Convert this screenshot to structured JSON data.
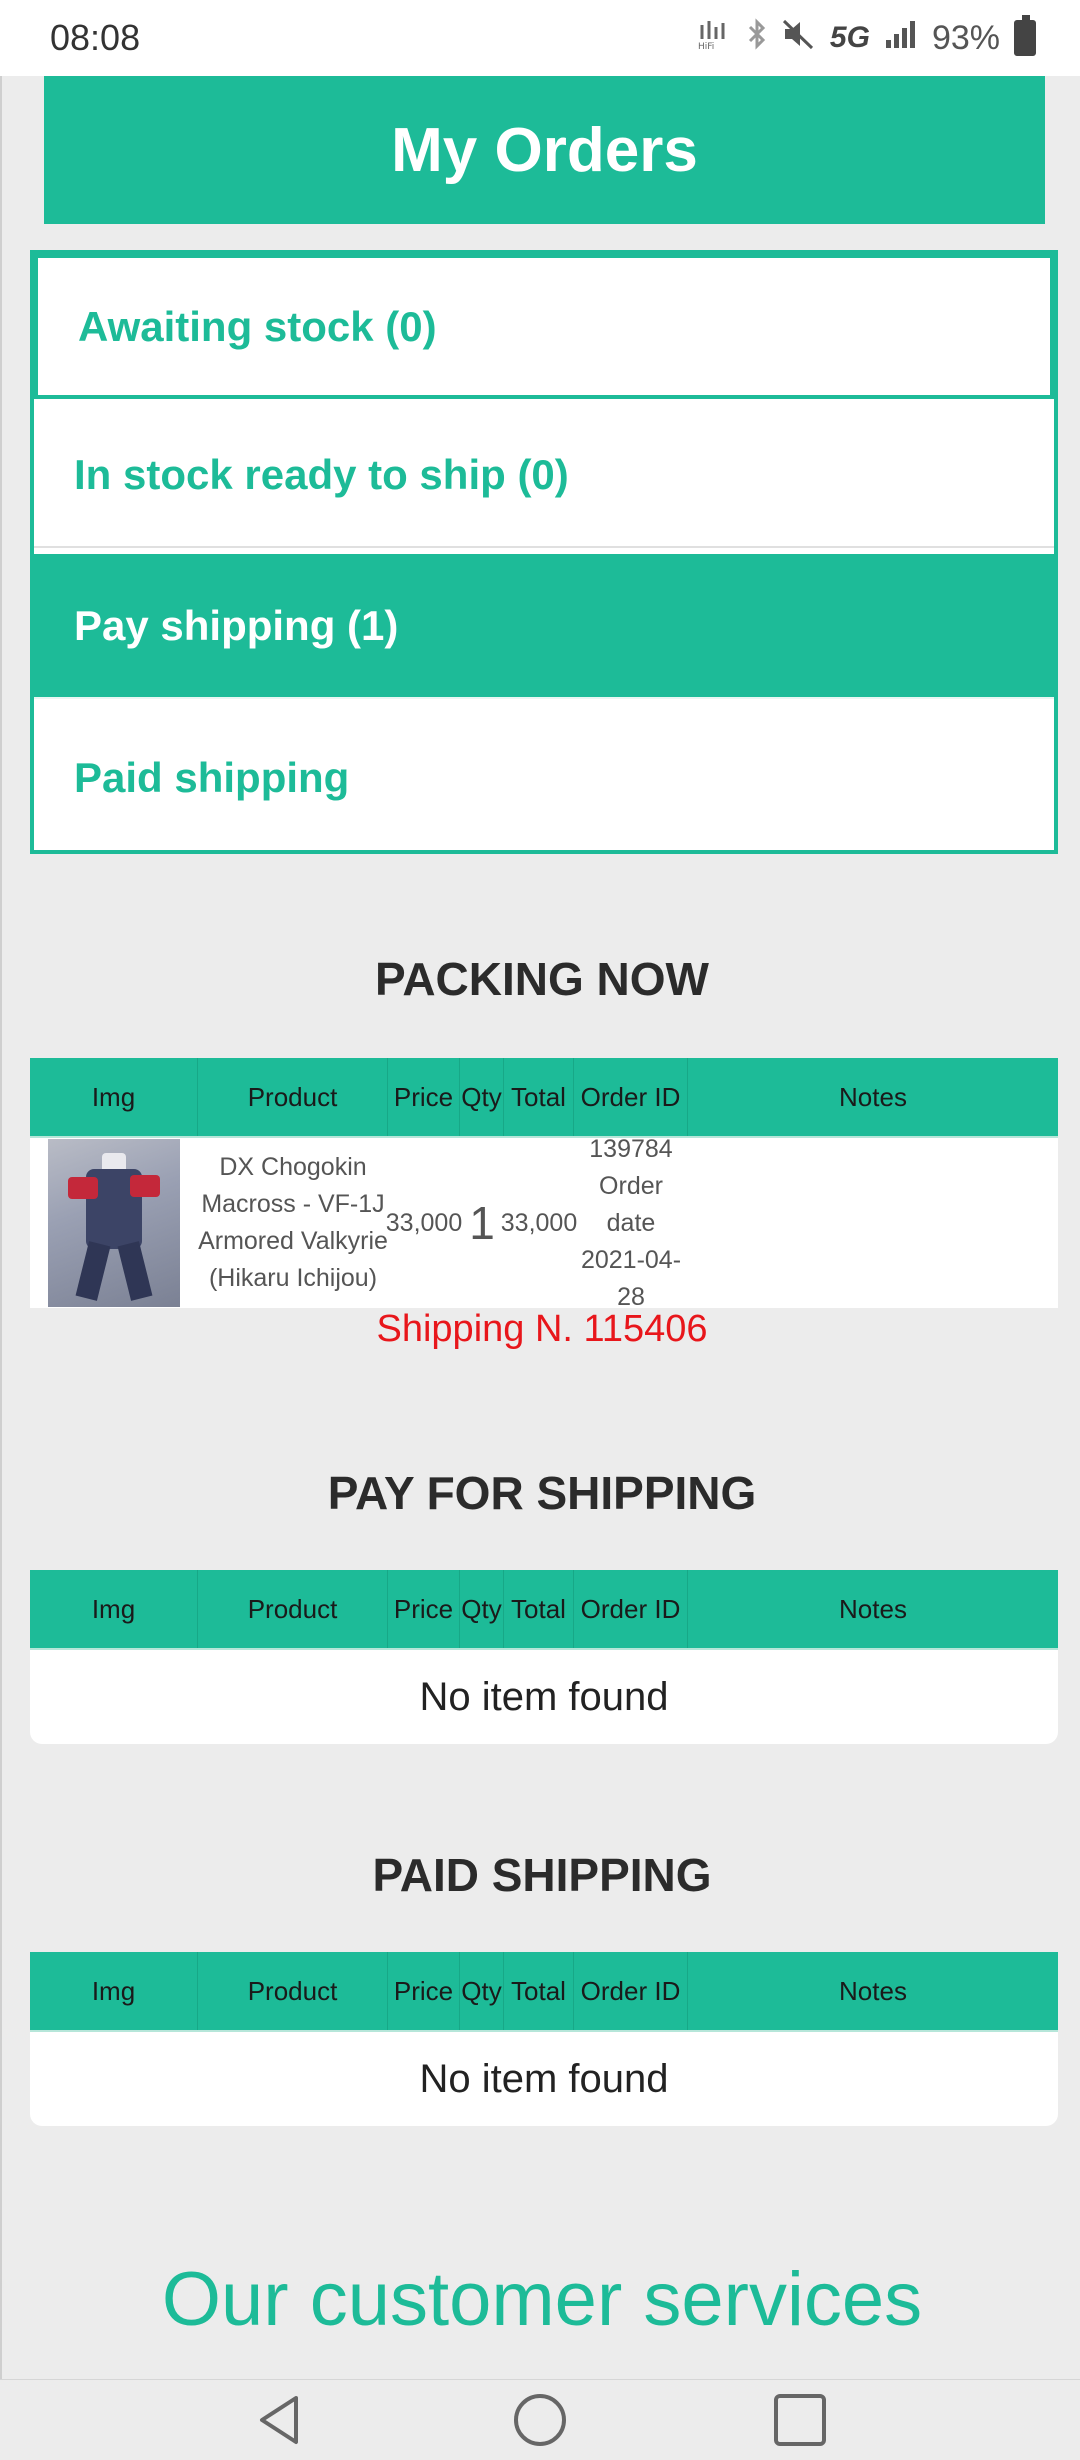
{
  "status": {
    "time": "08:08",
    "network": "5G",
    "battery": "93%"
  },
  "header": {
    "title": "My Orders"
  },
  "tabs": [
    {
      "label": "Awaiting stock (0)"
    },
    {
      "label": "In stock ready to ship (0)"
    },
    {
      "label": "Pay shipping (1)"
    },
    {
      "label": "Paid shipping"
    }
  ],
  "columns": [
    "Img",
    "Product",
    "Price",
    "Qty",
    "Total",
    "Order ID",
    "Notes"
  ],
  "packing": {
    "title": "PACKING NOW",
    "rows": [
      {
        "product": "DX Chogokin Macross - VF-1J Armored Valkyrie (Hikaru Ichijou)",
        "price": "33,000",
        "qty": "1",
        "total": "33,000",
        "order_id": "139784 Order date 2021-04-28",
        "notes": ""
      }
    ],
    "shipping_no": "Shipping N. 115406"
  },
  "pay_for_shipping": {
    "title": "PAY FOR SHIPPING",
    "empty": "No item found"
  },
  "paid_shipping": {
    "title": "PAID SHIPPING",
    "empty": "No item found"
  },
  "customer_services": {
    "title": "Our customer services"
  },
  "colors": {
    "accent": "#1dbb98",
    "shipping_no": "#e8161b"
  }
}
